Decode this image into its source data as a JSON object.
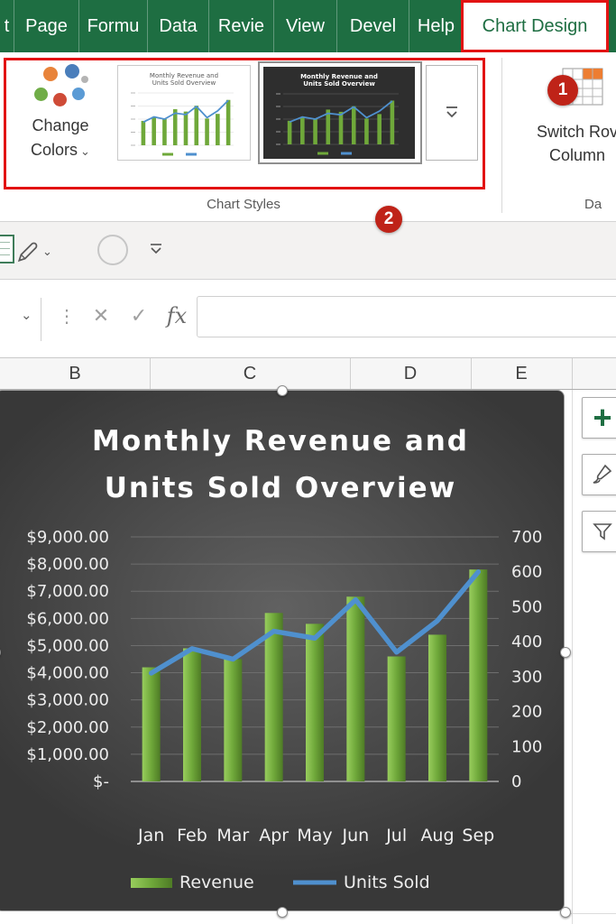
{
  "theme": {
    "excel_green": "#1e6e42",
    "box_red": "#e21313",
    "badge_red": "#bf2318",
    "qat_bg": "#f3f2f1",
    "chart_center": "#616161"
  },
  "icons": {
    "chevron_down": "⌄",
    "close": "✕",
    "check": "✓",
    "dots": "⋮",
    "plus": "+"
  },
  "ribbon": {
    "tabs": [
      "t",
      "Page",
      "Formu",
      "Data",
      "Revie",
      "View",
      "Devel",
      "Help",
      "Chart Design"
    ],
    "active_tab": "Chart Design",
    "change_colors": {
      "line1": "Change",
      "line2": "Colors"
    },
    "chart_styles_label": "Chart Styles",
    "switch_row_column": {
      "line1": "Switch Rov",
      "line2": "Column"
    },
    "data_label": "Da"
  },
  "annotations": {
    "badge1": "1",
    "badge2": "2"
  },
  "formula_bar": {
    "fx_label": "fx",
    "name_box_value": "",
    "formula_value": ""
  },
  "column_headers": [
    "B",
    "C",
    "D",
    "E"
  ],
  "chart_data": {
    "type": "combo",
    "title": "Monthly Revenue and Units Sold Overview",
    "title_lines": [
      "Monthly Revenue and",
      "Units Sold Overview"
    ],
    "categories": [
      "Jan",
      "Feb",
      "Mar",
      "Apr",
      "May",
      "Jun",
      "Jul",
      "Aug",
      "Sep"
    ],
    "series": [
      {
        "name": "Revenue",
        "type": "bar",
        "axis": "left",
        "color": "#6fa83a",
        "values": [
          4200,
          4900,
          4500,
          6200,
          5800,
          6800,
          4600,
          5400,
          7800
        ]
      },
      {
        "name": "Units Sold",
        "type": "line",
        "axis": "right",
        "color": "#4f90ce",
        "values": [
          310,
          380,
          350,
          430,
          410,
          520,
          370,
          460,
          600
        ]
      }
    ],
    "bar_gradient": [
      "#98cd5d",
      "#6fa83a",
      "#4e7b25"
    ],
    "left_axis": {
      "min": 0,
      "max": 9000,
      "labels": [
        "$9,000.00",
        "$8,000.00",
        "$7,000.00",
        "$6,000.00",
        "$5,000.00",
        "$4,000.00",
        "$3,000.00",
        "$2,000.00",
        "$1,000.00",
        "$-"
      ]
    },
    "right_axis": {
      "min": 0,
      "max": 700,
      "labels": [
        "700",
        "600",
        "500",
        "400",
        "300",
        "200",
        "100",
        "0"
      ]
    },
    "legend_position": "bottom",
    "grid": true,
    "background": "dark"
  }
}
